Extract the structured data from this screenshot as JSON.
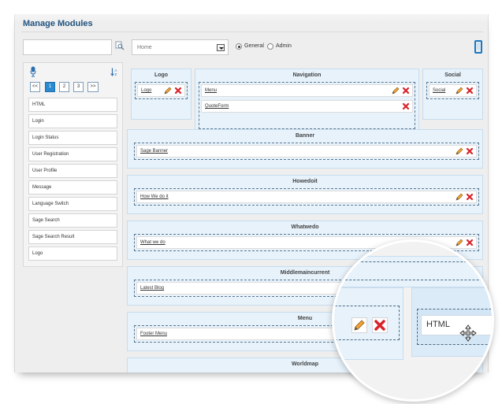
{
  "header": {
    "title": "Manage Modules"
  },
  "toolbar": {
    "search_placeholder": "",
    "page_select_value": "Home",
    "radio_general": "General",
    "radio_admin": "Admin",
    "selected_mode": "General"
  },
  "left_panel": {
    "pager": [
      "<<",
      "1",
      "2",
      "3",
      ">>"
    ],
    "active_page": "1",
    "modules": [
      "HTML",
      "Login",
      "Login Status",
      "User Registration",
      "User Profile",
      "Message",
      "Language Switch",
      "Sage Search",
      "Sage Search Result",
      "Logo"
    ]
  },
  "zones": {
    "logo": {
      "title": "Logo",
      "modules": [
        "Logo"
      ]
    },
    "navigation": {
      "title": "Navigation",
      "modules": [
        "Menu",
        "QuoteForm"
      ]
    },
    "social": {
      "title": "Social",
      "modules": [
        "Social"
      ]
    },
    "banner": {
      "title": "Banner",
      "modules": [
        "Sage Banner"
      ]
    },
    "howedoit": {
      "title": "Howedoit",
      "modules": [
        "How We do it"
      ]
    },
    "whatwedo": {
      "title": "Whatwedo",
      "modules": [
        "What we do"
      ]
    },
    "middlemaincurrent": {
      "title": "Middlemaincurrent",
      "modules": [
        "Latest Blog"
      ]
    },
    "menu": {
      "title": "Menu",
      "modules": [
        "Footer Menu"
      ]
    },
    "worldmap": {
      "title": "Worldmap",
      "modules": []
    }
  },
  "magnifier": {
    "dragged_module": "HTML"
  },
  "colors": {
    "accent": "#1a4e7c",
    "zone_bg": "#e7f2fb",
    "pager_active": "#2c8ad0",
    "delete": "#d8232a",
    "edit": "#f2a33a"
  }
}
